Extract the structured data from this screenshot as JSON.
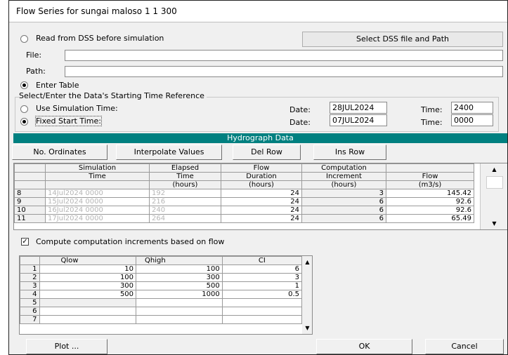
{
  "window": {
    "title": "Flow Series for sungai maloso 1 1 300"
  },
  "source": {
    "read_dss_label": "Read from DSS before simulation",
    "select_dss_button": "Select DSS file and Path",
    "file_label": "File:",
    "file_value": "",
    "path_label": "Path:",
    "path_value": "",
    "enter_table_label": "Enter Table",
    "selected": "Enter Table"
  },
  "time_reference": {
    "group_label": "Select/Enter the Data's Starting Time Reference",
    "use_sim_label": "Use Simulation Time:",
    "fixed_label": "Fixed Start Time:",
    "selected": "Fixed Start Time:",
    "date_label": "Date:",
    "time_label": "Time:",
    "sim_date": "28JUL2024",
    "sim_time": "2400",
    "fixed_date": "07JUL2024",
    "fixed_time": "0000"
  },
  "hydrograph": {
    "bar_title": "Hydrograph Data",
    "buttons": {
      "ordinates": "No. Ordinates",
      "interpolate": "Interpolate Values",
      "del_row": "Del Row",
      "ins_row": "Ins Row"
    },
    "headers": {
      "row1": [
        "Simulation",
        "Elapsed",
        "Flow",
        "Computation",
        ""
      ],
      "row2": [
        "Time",
        "Time",
        "Duration",
        "Increment",
        "Flow"
      ],
      "row3": [
        "",
        "(hours)",
        "(hours)",
        "(hours)",
        "(m3/s)"
      ]
    },
    "rows": [
      {
        "idx": "8",
        "sim_time": "14Jul2024 0000",
        "elapsed": "192",
        "duration": "24",
        "increment": "3",
        "flow": "145.42"
      },
      {
        "idx": "9",
        "sim_time": "15Jul2024 0000",
        "elapsed": "216",
        "duration": "24",
        "increment": "6",
        "flow": "92.6"
      },
      {
        "idx": "10",
        "sim_time": "16Jul2024 0000",
        "elapsed": "240",
        "duration": "24",
        "increment": "6",
        "flow": "92.6"
      },
      {
        "idx": "11",
        "sim_time": "17Jul2024 0000",
        "elapsed": "264",
        "duration": "24",
        "increment": "6",
        "flow": "65.49"
      }
    ]
  },
  "compute": {
    "checkbox_label": "Compute computation increments based on flow",
    "checked": true,
    "headers": [
      "",
      "Qlow",
      "Qhigh",
      "CI"
    ],
    "rows": [
      {
        "idx": "1",
        "qlow": "10",
        "qhigh": "100",
        "ci": "6"
      },
      {
        "idx": "2",
        "qlow": "100",
        "qhigh": "300",
        "ci": "3"
      },
      {
        "idx": "3",
        "qlow": "300",
        "qhigh": "500",
        "ci": "1"
      },
      {
        "idx": "4",
        "qlow": "500",
        "qhigh": "1000",
        "ci": "0.5"
      },
      {
        "idx": "5",
        "qlow": "",
        "qhigh": "",
        "ci": ""
      },
      {
        "idx": "6",
        "qlow": "",
        "qhigh": "",
        "ci": ""
      },
      {
        "idx": "7",
        "qlow": "",
        "qhigh": "",
        "ci": ""
      }
    ]
  },
  "footer": {
    "plot": "Plot ...",
    "ok": "OK",
    "cancel": "Cancel"
  },
  "colors": {
    "accent": "#008080",
    "window_bg": "#f0f0f0",
    "disabled_text": "#b6b6b6"
  }
}
